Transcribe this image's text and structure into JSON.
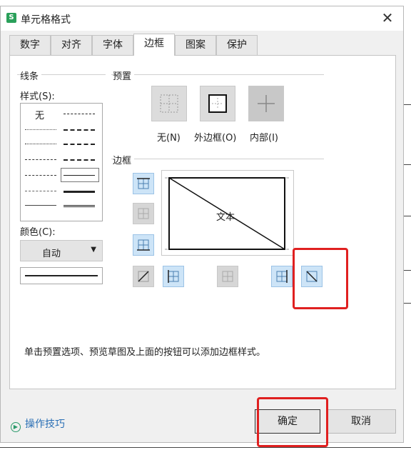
{
  "dialog": {
    "title": "单元格格式",
    "app_icon_letter": "S"
  },
  "tabs": [
    "数字",
    "对齐",
    "字体",
    "边框",
    "图案",
    "保护"
  ],
  "active_tab": "边框",
  "line_group": {
    "label": "线条",
    "style_label": "样式(S):",
    "none_label": "无",
    "color_label": "颜色(C):",
    "color_value": "自动"
  },
  "preset_group": {
    "label": "预置",
    "buttons": [
      "无(N)",
      "外边框(O)",
      "内部(I)"
    ]
  },
  "border_group": {
    "label": "边框",
    "preview_text": "文本"
  },
  "hint": "单击预置选项、预览草图及上面的按钮可以添加边框样式。",
  "tips_label": "操作技巧",
  "ok_label": "确定",
  "cancel_label": "取消",
  "colors": {
    "highlight": "#e02020",
    "selected_btn_bg": "#cde4f7",
    "selected_btn_border": "#9cc3e6",
    "tips_link": "#2a6fb5"
  }
}
